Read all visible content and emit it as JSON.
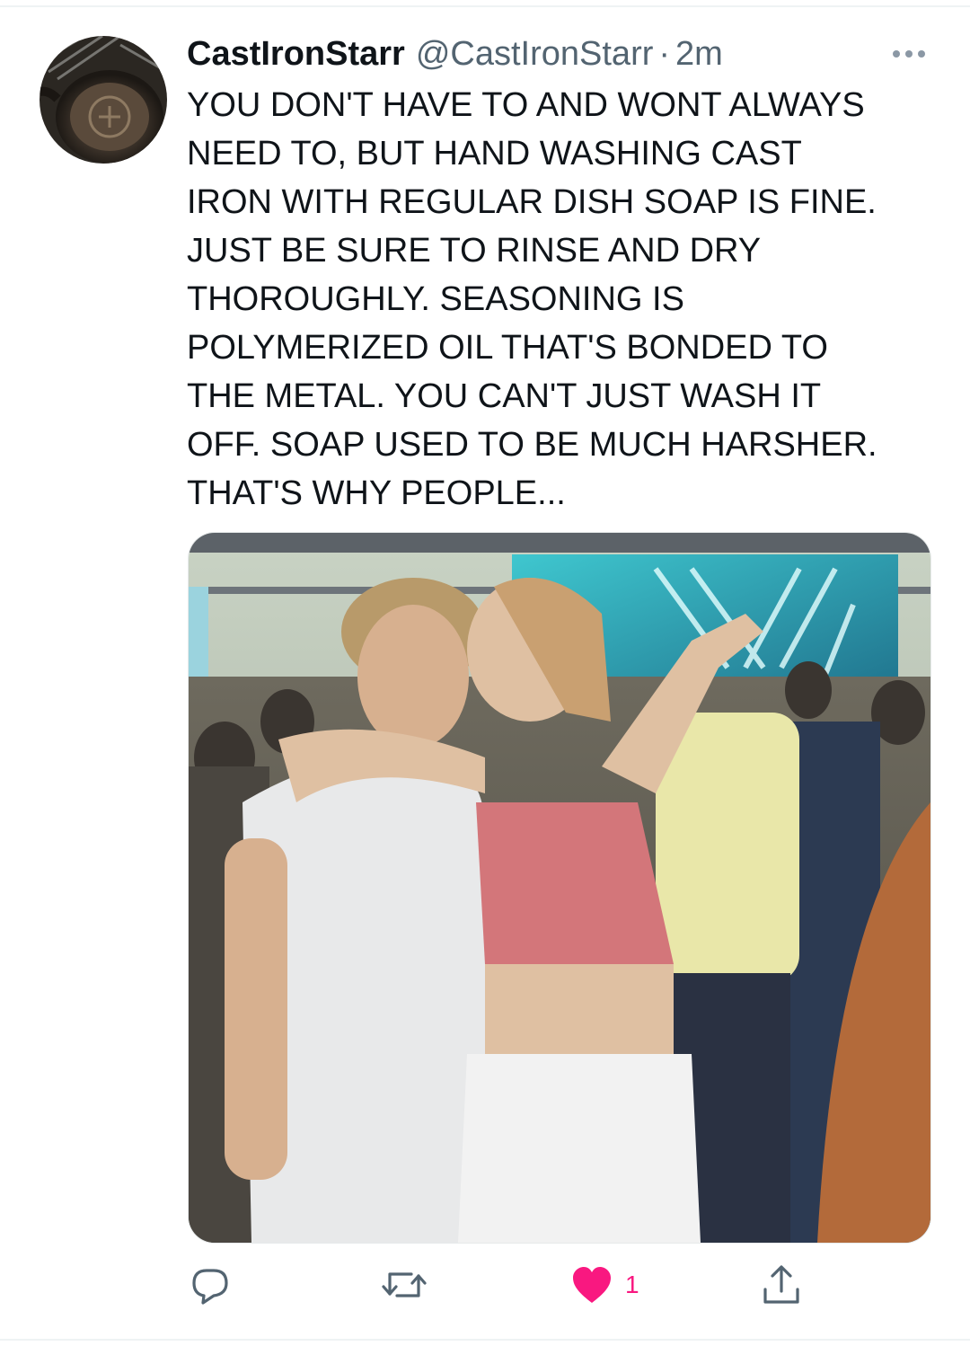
{
  "tweet": {
    "display_name": "CastIronStarr",
    "handle": "@CastIronStarr",
    "separator": "·",
    "timestamp": "2m",
    "text_lines": [
      "YOU DON'T HAVE TO AND WONT ALWAYS",
      "NEED TO, BUT HAND WASHING CAST",
      "IRON WITH REGULAR DISH SOAP IS FINE.",
      "JUST BE SURE TO RINSE AND DRY",
      "THOROUGHLY. SEASONING IS",
      "POLYMERIZED OIL THAT'S BONDED TO",
      "THE METAL. YOU CAN'T JUST WASH IT",
      "OFF. SOAP USED TO BE MUCH HARSHER.",
      "THAT'S WHY PEOPLE..."
    ]
  },
  "actions": {
    "like_count": "1"
  },
  "icons": {
    "avatar": "cast-iron-skillet-avatar",
    "more": "more-icon",
    "reply": "reply-icon",
    "retweet": "retweet-icon",
    "like": "heart-icon",
    "share": "share-icon"
  },
  "colors": {
    "text": "#0f1419",
    "secondary": "#536471",
    "like": "#f91880",
    "divider": "#eff3f4"
  }
}
